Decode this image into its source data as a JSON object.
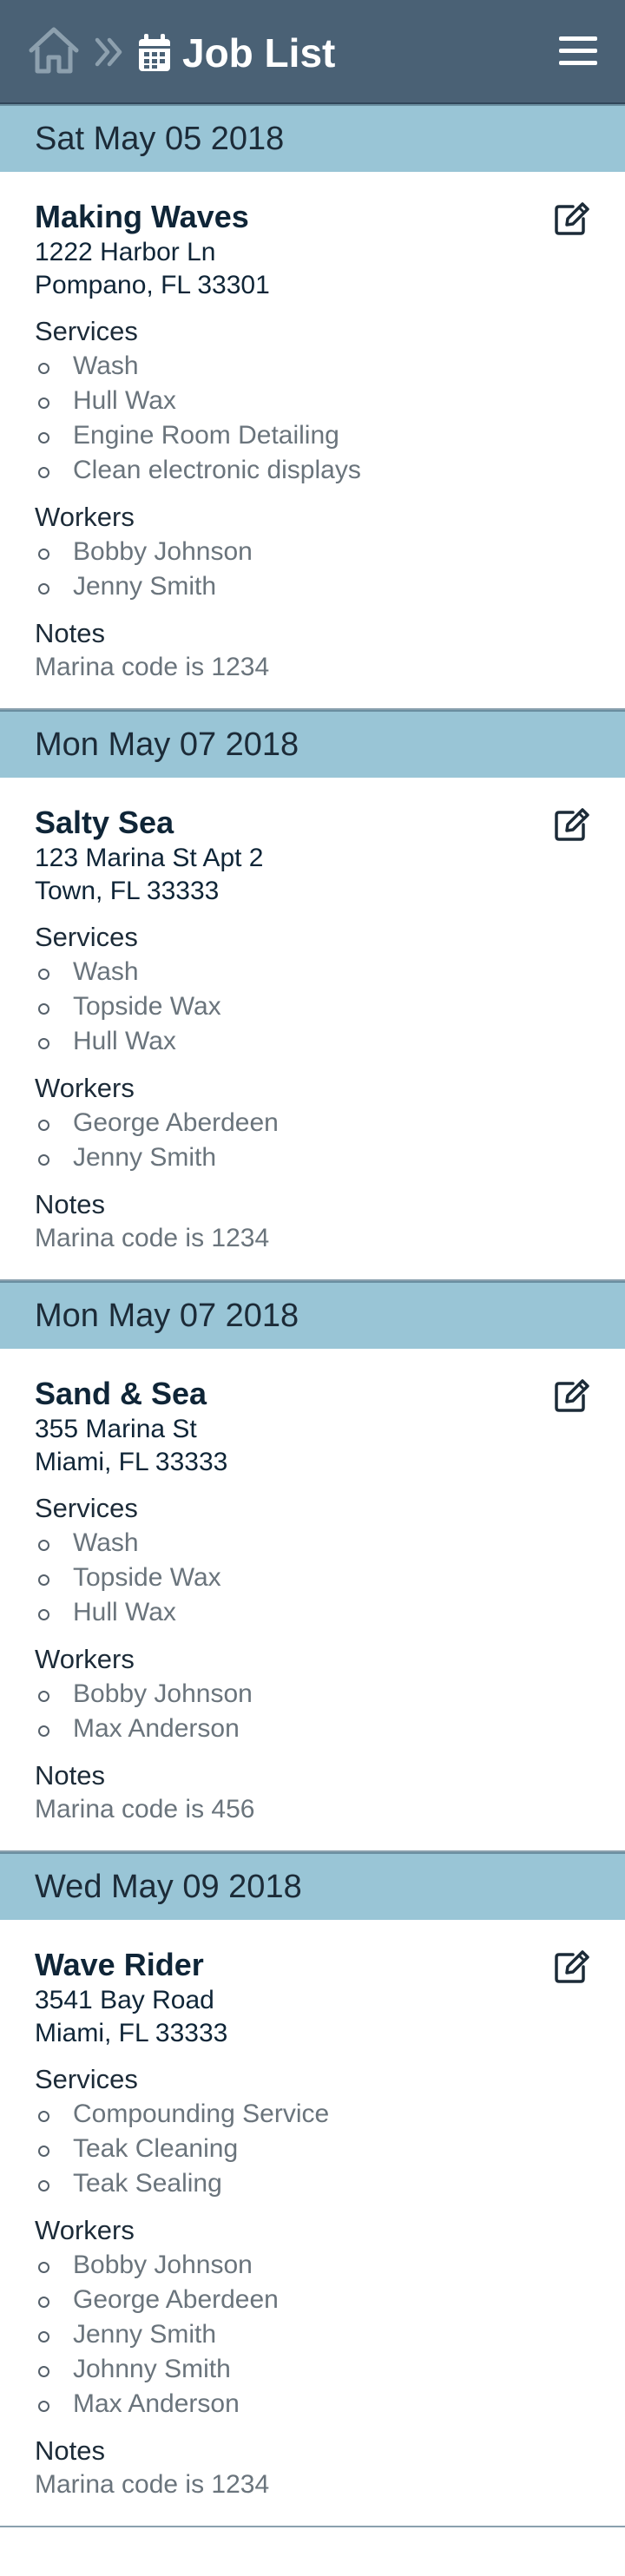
{
  "header": {
    "title": "Job List",
    "home_icon": "home-icon",
    "breadcrumb_icon": "chevron-double-right-icon",
    "calendar_icon": "calendar-icon",
    "menu_icon": "hamburger-menu-icon"
  },
  "labels": {
    "services": "Services",
    "workers": "Workers",
    "notes": "Notes"
  },
  "colors": {
    "header_bg": "#4a6175",
    "date_bar_bg": "#99c5d6"
  },
  "jobs": [
    {
      "date": "Sat May 05 2018",
      "name": "Making Waves",
      "address_line1": "1222 Harbor Ln",
      "address_line2": "Pompano, FL 33301",
      "services": [
        "Wash",
        "Hull Wax",
        "Engine Room Detailing",
        "Clean electronic displays"
      ],
      "workers": [
        "Bobby Johnson",
        "Jenny Smith"
      ],
      "notes": "Marina code is 1234"
    },
    {
      "date": "Mon May 07 2018",
      "name": "Salty Sea",
      "address_line1": "123 Marina St Apt 2",
      "address_line2": "Town, FL 33333",
      "services": [
        "Wash",
        "Topside Wax",
        "Hull Wax"
      ],
      "workers": [
        "George Aberdeen",
        "Jenny Smith"
      ],
      "notes": "Marina code is 1234"
    },
    {
      "date": "Mon May 07 2018",
      "name": "Sand & Sea",
      "address_line1": "355 Marina St",
      "address_line2": "Miami, FL 33333",
      "services": [
        "Wash",
        "Topside Wax",
        "Hull Wax"
      ],
      "workers": [
        "Bobby Johnson",
        "Max Anderson"
      ],
      "notes": "Marina code is 456"
    },
    {
      "date": "Wed May 09 2018",
      "name": "Wave Rider",
      "address_line1": "3541 Bay Road",
      "address_line2": "Miami, FL 33333",
      "services": [
        "Compounding Service",
        "Teak Cleaning",
        "Teak Sealing"
      ],
      "workers": [
        "Bobby Johnson",
        "George Aberdeen",
        "Jenny Smith",
        "Johnny Smith",
        "Max Anderson"
      ],
      "notes": "Marina code is 1234"
    }
  ]
}
